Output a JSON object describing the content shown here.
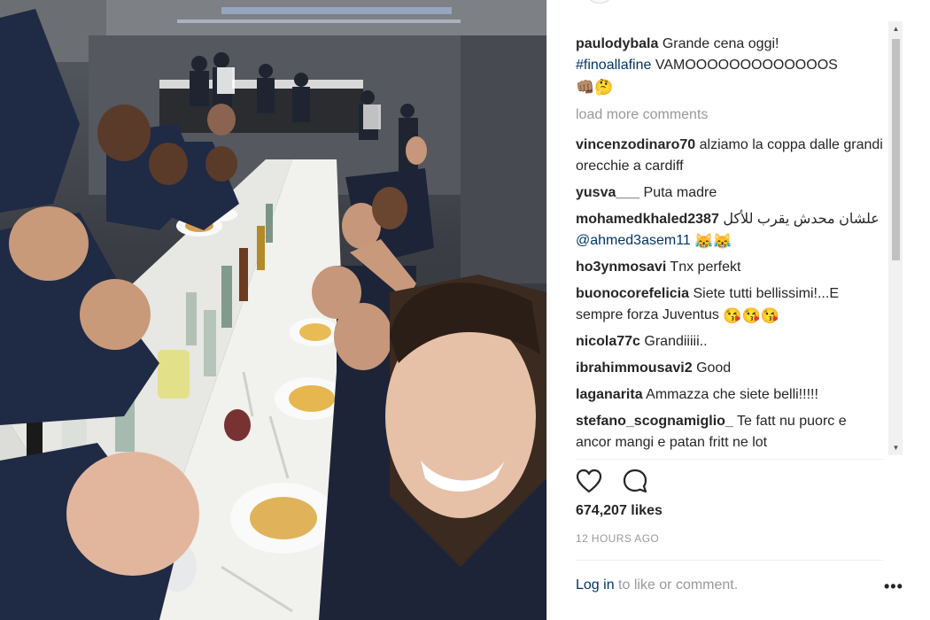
{
  "photo": {
    "description_icon": "group-selfie-photo"
  },
  "post": {
    "caption": {
      "username": "paulodybala",
      "text": "Grande cena oggi!",
      "hashtag": "#finoallafine",
      "shout": "VAMOOOOOOOOOOOOOS",
      "emojis": "👊🏽🤔"
    },
    "load_more": "load more comments",
    "comments": [
      {
        "username": "vincenzodinaro70",
        "text": "alziamo la coppa dalle grandi orecchie a cardiff"
      },
      {
        "username": "yusva___",
        "text": "Puta madre"
      },
      {
        "username": "mohamedkhaled2387",
        "text": "علشان محدش يقرب للأكل",
        "mention": "@ahmed3asem11",
        "emojis": "😹😹"
      },
      {
        "username": "ho3ynmosavi",
        "text": "Tnx perfekt"
      },
      {
        "username": "buonocorefelicia",
        "text": "Siete tutti bellissimi!...E sempre forza Juventus",
        "emojis": "😘😘😘"
      },
      {
        "username": "nicola77c",
        "text": "Grandiiiii.."
      },
      {
        "username": "ibrahimmousavi2",
        "text": "Good"
      },
      {
        "username": "laganarita",
        "text": "Ammazza che siete belli!!!!!"
      },
      {
        "username": "stefano_scognamiglio_",
        "text": "Te fatt nu puorc e ancor mangi e patan fritt ne lot"
      }
    ],
    "likes": "674,207 likes",
    "timestamp": "12 HOURS AGO",
    "login_link": "Log in",
    "login_rest": " to like or comment.",
    "more_label": "•••"
  },
  "colors": {
    "link": "#003569",
    "muted": "#999999",
    "text": "#262626"
  }
}
